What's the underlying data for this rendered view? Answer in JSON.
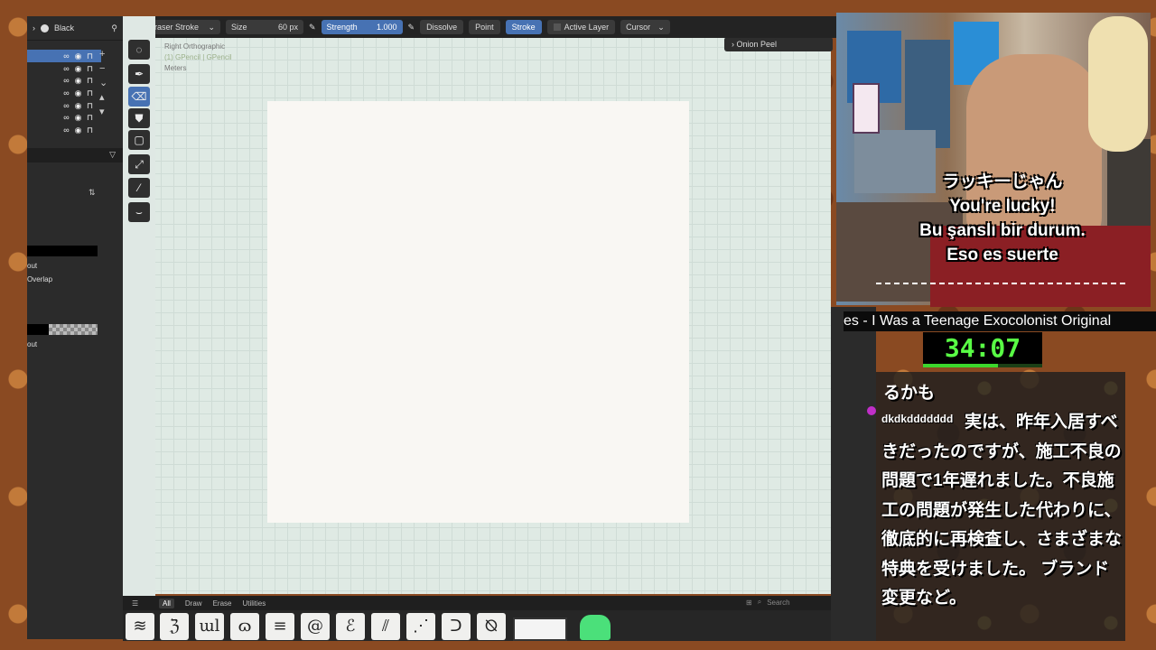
{
  "outliner": {
    "layer_label": "Black",
    "rows": 7,
    "labels": [
      "out",
      "Overlap",
      "out"
    ]
  },
  "toolbar": {
    "brush_name": "Eraser Stroke",
    "size_label": "Size",
    "size_value": "60 px",
    "strength_label": "Strength",
    "strength_value": "1.000",
    "mode_dissolve": "Dissolve",
    "mode_point": "Point",
    "mode_stroke": "Stroke",
    "active_layer": "Active Layer",
    "cursor": "Cursor"
  },
  "viewport": {
    "view_name": "Right Orthographic",
    "object_name": "(1) GPencil | GPencil",
    "units": "Meters",
    "onion_peel": "Onion Peel"
  },
  "asset_tabs": [
    "All",
    "Draw",
    "Erase",
    "Utilities"
  ],
  "asset_search_placeholder": "Search",
  "brushes": [
    "≋",
    "ℨ",
    "ɯl",
    "ɷ",
    "≡",
    "@",
    "ℰ",
    "⫽",
    "⋰",
    "ᑐ",
    "⦰"
  ],
  "stream": {
    "ticker": "es - I Was a Teenage Exocolonist Original",
    "timer": "34:07",
    "timer_progress": 0.63,
    "subtitles": [
      "ラッキーじゃん",
      "You're lucky!",
      "Bu şanslı bir durum.",
      "Eso es suerte"
    ],
    "chat_prev": "るかも",
    "chat_user": "dkdkddddddd",
    "chat_message": "実は、昨年入居すべきだったのですが、施工不良の問題で1年遅れました。不良施工の問題が発生した代わりに、徹底的に再検査し、さまざまな特典を受けました。 ブランド変更など。"
  }
}
